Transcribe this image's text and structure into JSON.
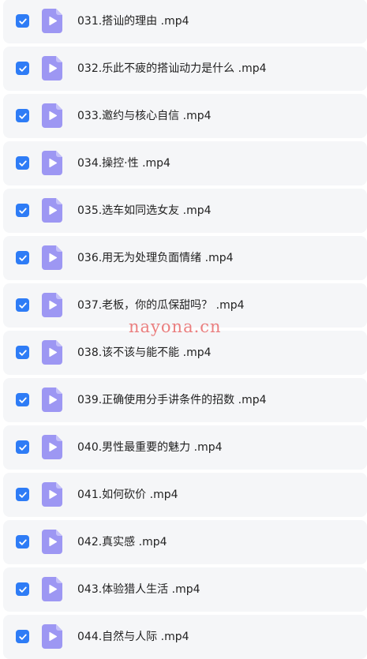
{
  "files": [
    {
      "name": "031.搭讪的理由 .mp4",
      "checked": true
    },
    {
      "name": "032.乐此不疲的搭讪动力是什么 .mp4",
      "checked": true
    },
    {
      "name": "033.邀约与核心自信 .mp4",
      "checked": true
    },
    {
      "name": "034.操控·性 .mp4",
      "checked": true
    },
    {
      "name": "035.选车如同选女友 .mp4",
      "checked": true
    },
    {
      "name": "036.用无为处理负面情绪 .mp4",
      "checked": true
    },
    {
      "name": "037.老板，你的瓜保甜吗？ .mp4",
      "checked": true
    },
    {
      "name": "038.该不该与能不能 .mp4",
      "checked": true
    },
    {
      "name": "039.正确使用分手讲条件的招数 .mp4",
      "checked": true
    },
    {
      "name": "040.男性最重要的魅力 .mp4",
      "checked": true
    },
    {
      "name": "041.如何砍价 .mp4",
      "checked": true
    },
    {
      "name": "042.真实感 .mp4",
      "checked": true
    },
    {
      "name": "043.体验猎人生活 .mp4",
      "checked": true
    },
    {
      "name": "044.自然与人际 .mp4",
      "checked": true
    }
  ],
  "icons": {
    "checkbox": "check-icon",
    "file": "video-file-play-icon"
  },
  "colors": {
    "checkbox": "#2e7cf6",
    "file_icon": "#9d97f3",
    "row_background": "#f5f6f8",
    "watermark": "#e96a6a"
  },
  "watermark": "nayona.cn"
}
